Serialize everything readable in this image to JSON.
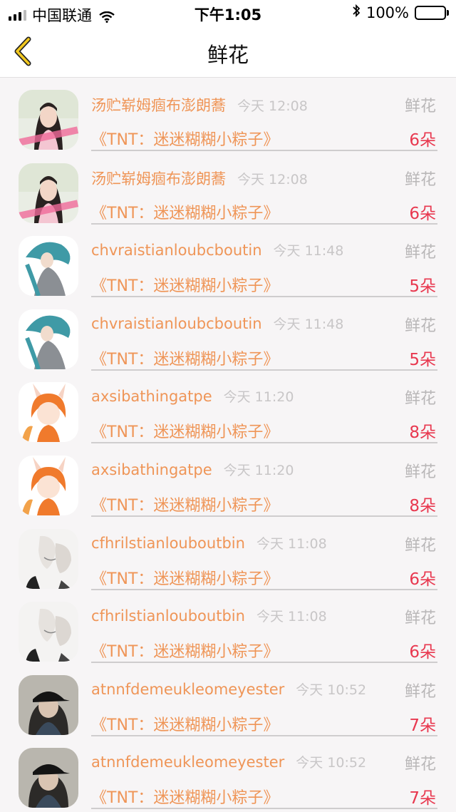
{
  "status_bar": {
    "carrier": "中国联通",
    "time": "下午1:05",
    "battery": "100%"
  },
  "nav": {
    "title": "鲜花"
  },
  "rows": [
    {
      "name": "汤贮崭姆痼布澎朗蕎",
      "time": "今天 12:08",
      "gift": "鲜花",
      "book": "《TNT：迷迷糊糊小粽子》",
      "count": "6朵",
      "avatar": "girl-pink"
    },
    {
      "name": "汤贮崭姆痼布澎朗蕎",
      "time": "今天 12:08",
      "gift": "鲜花",
      "book": "《TNT：迷迷糊糊小粽子》",
      "count": "6朵",
      "avatar": "girl-pink"
    },
    {
      "name": "chvraistianloubcboutin",
      "time": "今天 11:48",
      "gift": "鲜花",
      "book": "《TNT：迷迷糊糊小粽子》",
      "count": "5朵",
      "avatar": "teal-hair"
    },
    {
      "name": "chvraistianloubcboutin",
      "time": "今天 11:48",
      "gift": "鲜花",
      "book": "《TNT：迷迷糊糊小粽子》",
      "count": "5朵",
      "avatar": "teal-hair"
    },
    {
      "name": "axsibathingatpe",
      "time": "今天 11:20",
      "gift": "鲜花",
      "book": "《TNT：迷迷糊糊小粽子》",
      "count": "8朵",
      "avatar": "bunny-girl"
    },
    {
      "name": "axsibathingatpe",
      "time": "今天 11:20",
      "gift": "鲜花",
      "book": "《TNT：迷迷糊糊小粽子》",
      "count": "8朵",
      "avatar": "bunny-girl"
    },
    {
      "name": "cfhrilstianlouboutbin",
      "time": "今天 11:08",
      "gift": "鲜花",
      "book": "《TNT：迷迷糊糊小粽子》",
      "count": "6朵",
      "avatar": "sketch-couple"
    },
    {
      "name": "cfhrilstianlouboutbin",
      "time": "今天 11:08",
      "gift": "鲜花",
      "book": "《TNT：迷迷糊糊小粽子》",
      "count": "6朵",
      "avatar": "sketch-couple"
    },
    {
      "name": "atnnfdemeukleomeyester",
      "time": "今天 10:52",
      "gift": "鲜花",
      "book": "《TNT：迷迷糊糊小粽子》",
      "count": "7朵",
      "avatar": "cap-person"
    },
    {
      "name": "atnnfdemeukleomeyester",
      "time": "今天 10:52",
      "gift": "鲜花",
      "book": "《TNT：迷迷糊糊小粽子》",
      "count": "7朵",
      "avatar": "cap-person"
    }
  ],
  "colors": {
    "name": "#ef9557",
    "count": "#e8384f",
    "muted": "#c8c6c7",
    "back_arrow": "#f2c81f"
  }
}
